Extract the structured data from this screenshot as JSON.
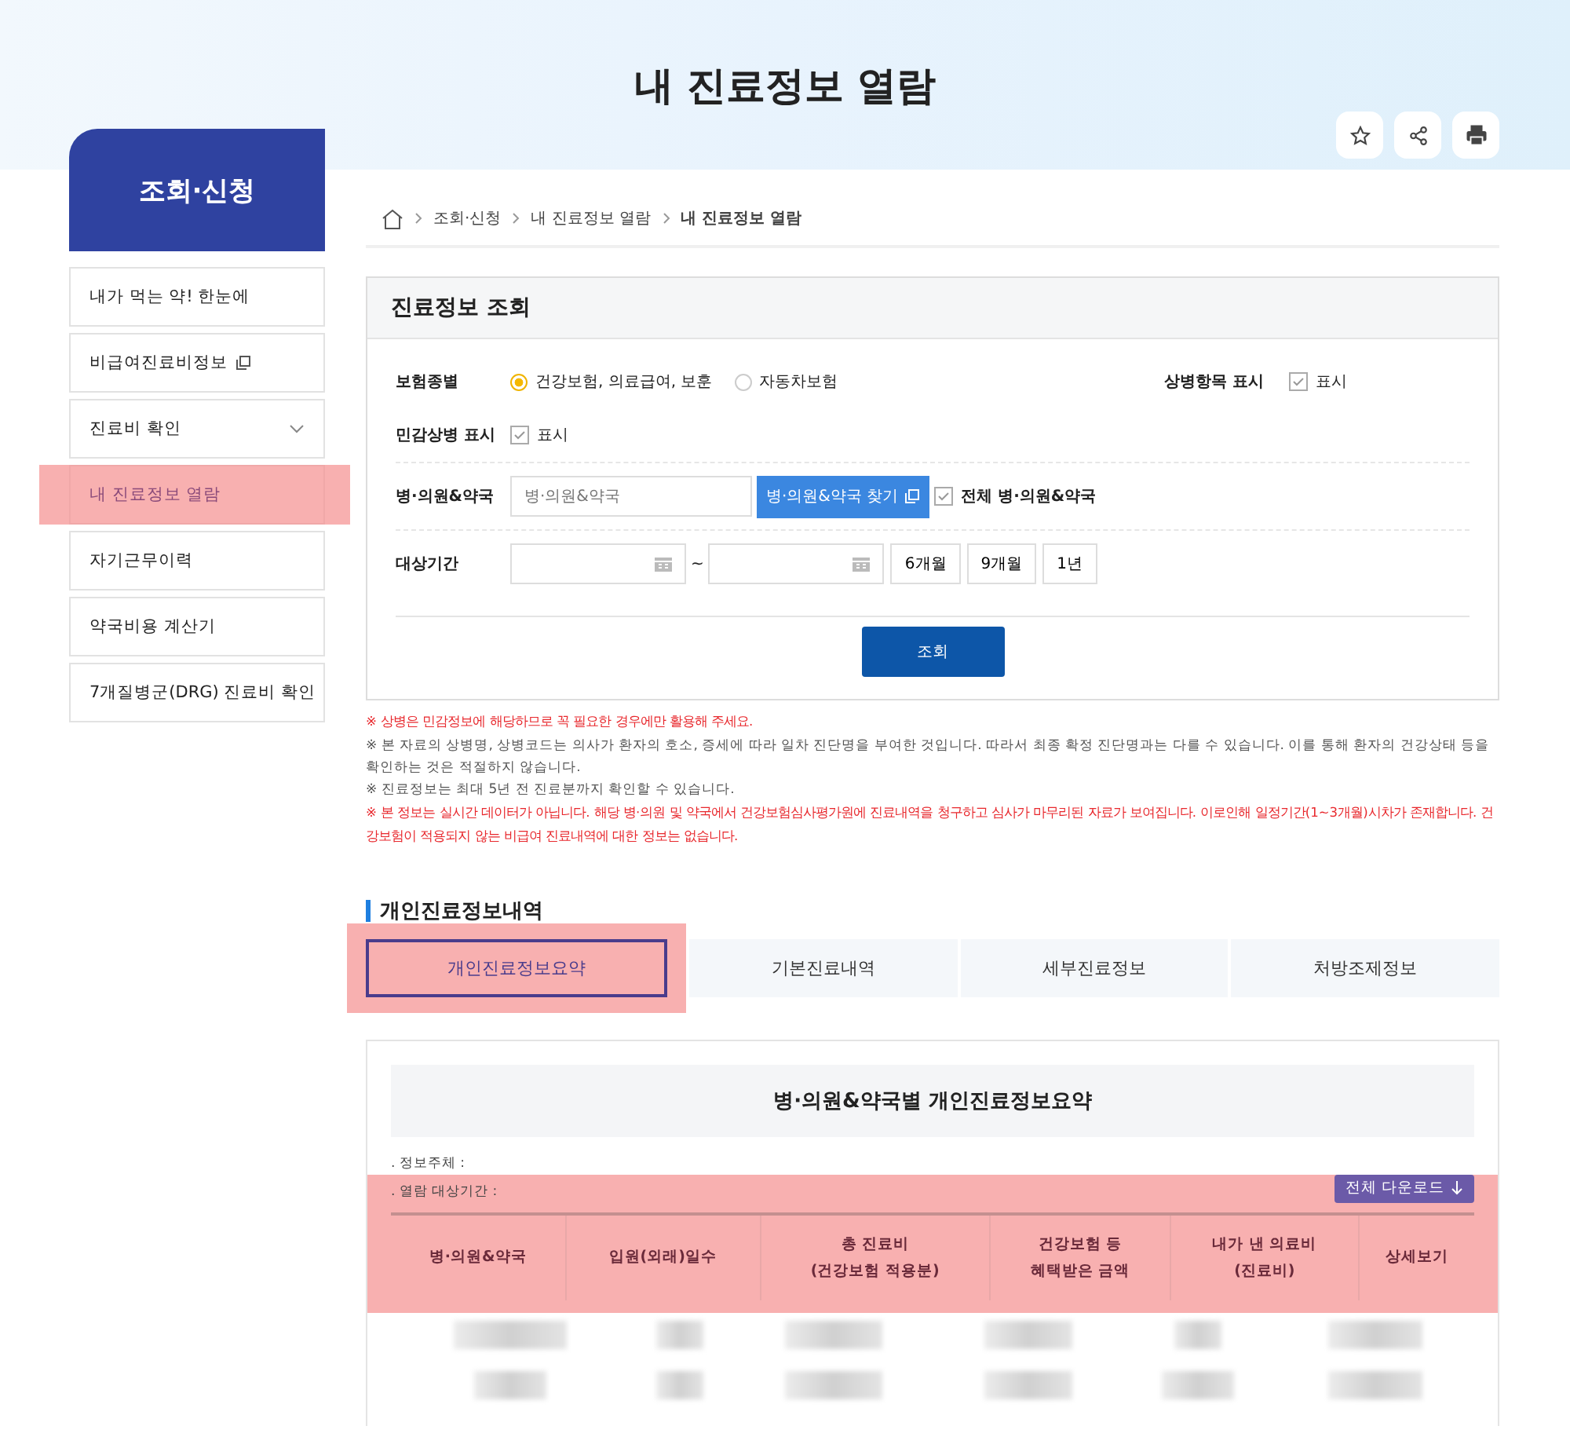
{
  "page_title": "내 진료정보 열람",
  "sidebar": {
    "title": "조회·신청",
    "items": [
      {
        "label": "내가 먹는 약! 한눈에",
        "kind": "link",
        "selected": false
      },
      {
        "label": "비급여진료비정보",
        "kind": "external",
        "selected": false
      },
      {
        "label": "진료비 확인",
        "kind": "expandable",
        "expanded": false,
        "selected": false
      },
      {
        "label": "내 진료정보 열람",
        "kind": "link",
        "selected": true
      },
      {
        "label": "자기근무이력",
        "kind": "link",
        "selected": false
      },
      {
        "label": "약국비용 계산기",
        "kind": "link",
        "selected": false
      },
      {
        "label": "7개질병군(DRG) 진료비 확인",
        "kind": "link",
        "selected": false
      }
    ]
  },
  "breadcrumb": [
    "조회·신청",
    "내 진료정보 열람",
    "내 진료정보 열람"
  ],
  "search_form": {
    "title": "진료정보 조회",
    "insurance": {
      "label": "보험종별",
      "options": [
        {
          "label": "건강보험, 의료급여, 보훈",
          "selected": true
        },
        {
          "label": "자동차보험",
          "selected": false
        }
      ]
    },
    "diagnosis_display": {
      "label": "상병항목 표시",
      "option": "표시",
      "checked": true
    },
    "sensitive_display": {
      "label": "민감상병 표시",
      "option": "표시",
      "checked": true
    },
    "hospital": {
      "label": "병·의원&약국",
      "placeholder": "병·의원&약국",
      "button": "병·의원&약국 찾기",
      "all_option": "전체 병·의원&약국",
      "all_checked": true
    },
    "period": {
      "label": "대상기간",
      "separator": "~",
      "presets": [
        "6개월",
        "9개월",
        "1년"
      ]
    },
    "submit": "조회"
  },
  "notes": [
    {
      "kind": "warning",
      "text": "※ 상병은 민감정보에 해당하므로 꼭 필요한 경우에만 활용해 주세요."
    },
    {
      "kind": "info",
      "text": "※ 본 자료의 상병명, 상병코드는 의사가 환자의 호소, 증세에 따라 일차 진단명을 부여한 것입니다. 따라서 최종 확정 진단명과는 다를 수 있습니다. 이를 통해 환자의 건강상태 등을 확인하는 것은 적절하지 않습니다."
    },
    {
      "kind": "info",
      "text": "※ 진료정보는 최대 5년 전 진료분까지 확인할 수 있습니다."
    },
    {
      "kind": "warning",
      "text": "※ 본 정보는 실시간 데이터가 아닙니다. 해당 병·의원 및 약국에서 건강보험심사평가원에 진료내역을 청구하고 심사가 마무리된 자료가 보여집니다. 이로인해 일정기간(1~3개월)시차가 존재합니다. 건강보험이 적용되지 않는 비급여 진료내역에 대한 정보는 없습니다."
    }
  ],
  "section_title": "개인진료정보내역",
  "tabs": [
    {
      "label": "개인진료정보요약",
      "selected": true
    },
    {
      "label": "기본진료내역",
      "selected": false
    },
    {
      "label": "세부진료정보",
      "selected": false
    },
    {
      "label": "처방조제정보",
      "selected": false
    }
  ],
  "summary": {
    "title": "병·의원&약국별 개인진료정보요약",
    "info_lines": [
      ". 정보주체 :",
      ". 열람 대상기간 :"
    ],
    "download_button": "전체 다운로드",
    "columns": [
      "병·의원&약국",
      "입원(외래)일수",
      "총 진료비\n(건강보험 적용분)",
      "건강보험 등\n혜택받은 금액",
      "내가 낸 의료비\n(진료비)",
      "상세보기"
    ]
  }
}
